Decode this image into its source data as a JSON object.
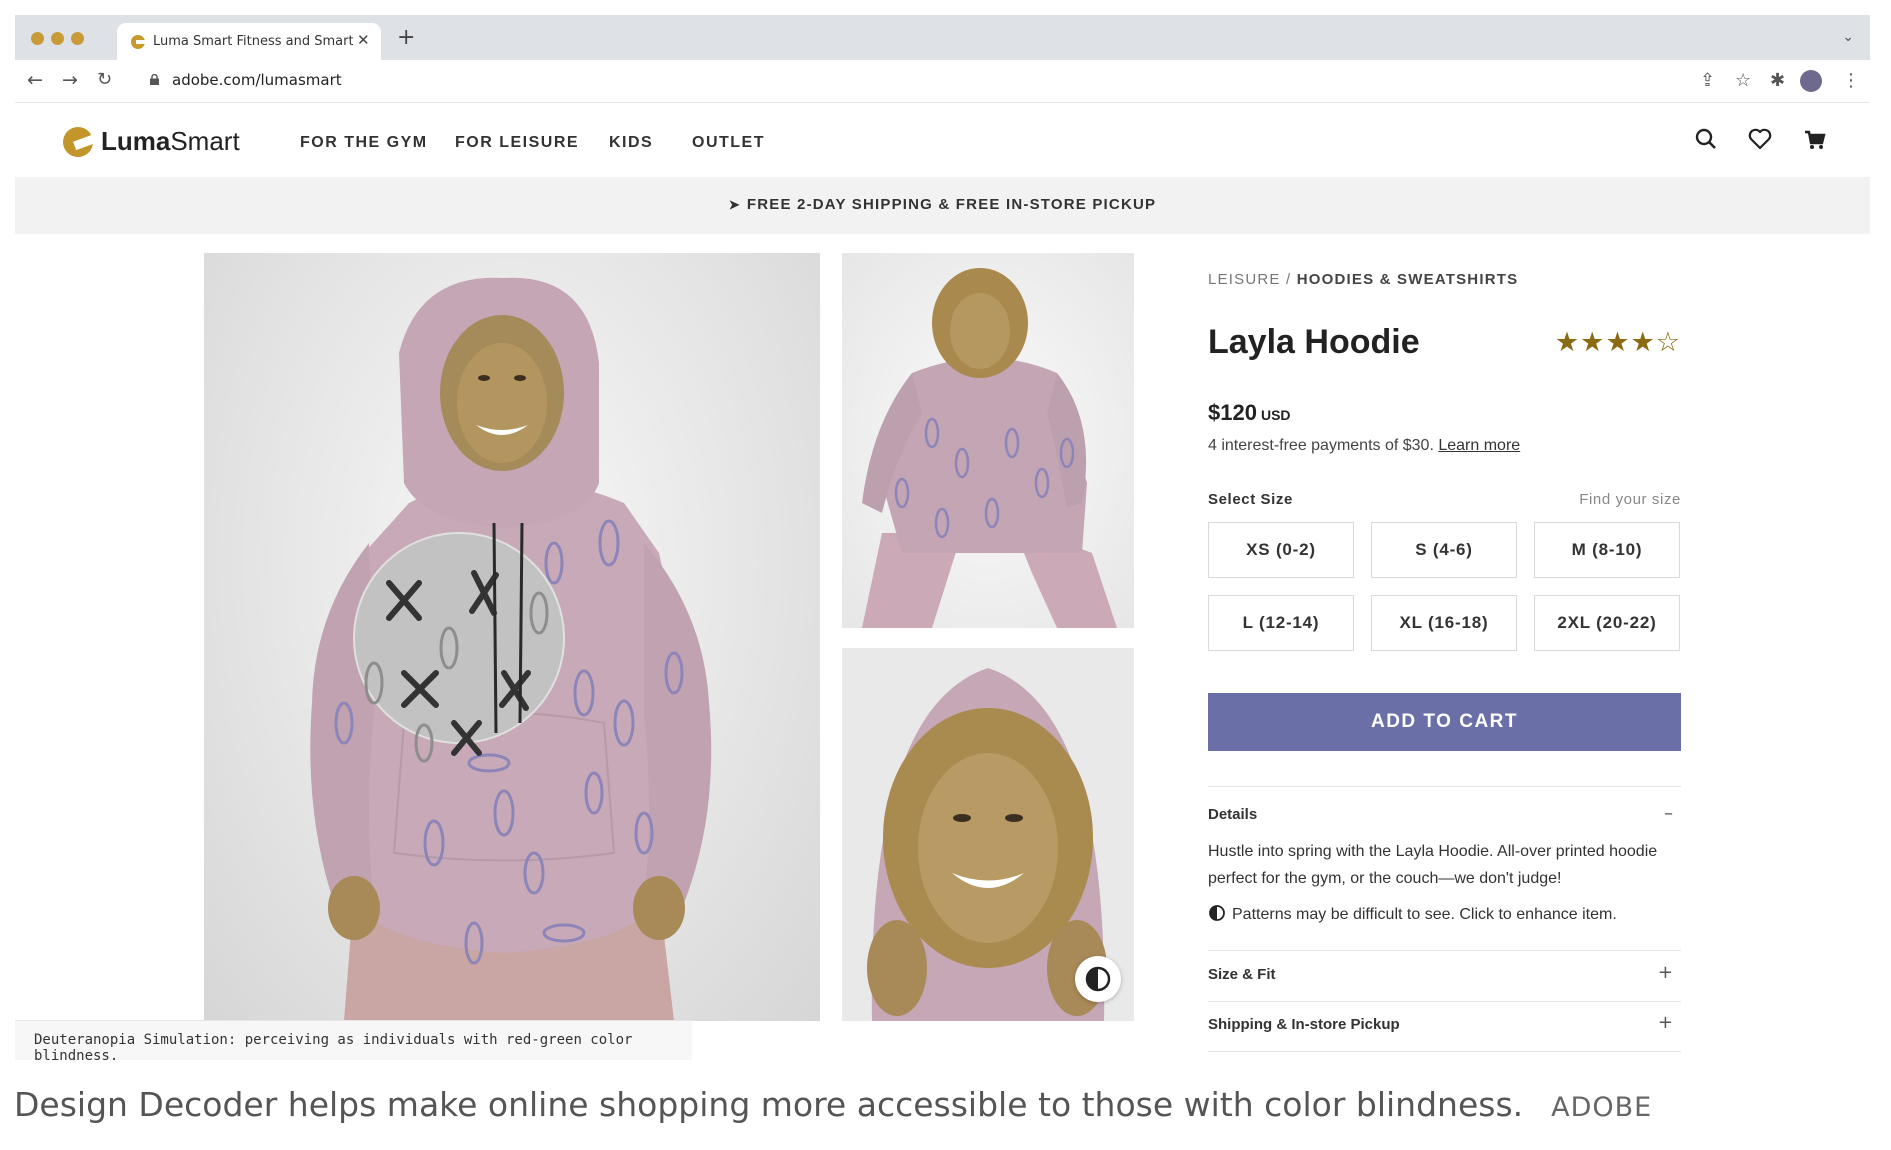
{
  "browser": {
    "tab_title": "Luma Smart Fitness and Smart",
    "url": "adobe.com/lumasmart",
    "new_tab": "+",
    "close_tab": "✕"
  },
  "site": {
    "logo": {
      "bold": "Luma",
      "regular": "Smart"
    },
    "nav": [
      "FOR THE GYM",
      "FOR LEISURE",
      "KIDS",
      "OUTLET"
    ],
    "promo": "FREE 2-DAY SHIPPING & FREE IN-STORE PICKUP"
  },
  "product": {
    "breadcrumb": {
      "parent": "LEISURE",
      "separator": " / ",
      "current": "HOODIES & SWEATSHIRTS"
    },
    "title": "Layla Hoodie",
    "rating": 4,
    "rating_max": 5,
    "price": "$120",
    "currency": "USD",
    "installments": "4 interest-free payments of $30.",
    "learn_more": "Learn more",
    "size_label": "Select Size",
    "size_guide": "Find your size",
    "sizes": [
      "XS (0-2)",
      "S (4-6)",
      "M (8-10)",
      "L (12-14)",
      "XL (16-18)",
      "2XL (20-22)"
    ],
    "add_to_cart": "ADD TO CART",
    "accordions": [
      {
        "title": "Details",
        "toggle": "–"
      },
      {
        "title": "Size & Fit",
        "toggle": "+"
      },
      {
        "title": "Shipping & In-store Pickup",
        "toggle": "+"
      }
    ],
    "details_text": "Hustle into spring with the Layla Hoodie. All-over printed hoodie perfect for the gym, or the couch—we don't judge!",
    "contrast_note": "Patterns may be difficult to see. Click to enhance item."
  },
  "simulation_caption": "Deuteranopia Simulation: perceiving as individuals with red-green color blindness.",
  "article_caption": {
    "text": "Design Decoder helps make online shopping more accessible to those with color blindness.",
    "credit": "ADOBE"
  },
  "colors": {
    "accent": "#6a6fa8",
    "brand_gold": "#c3962c",
    "star": "#8a6a12",
    "hoodie": "#c8a9b8"
  }
}
